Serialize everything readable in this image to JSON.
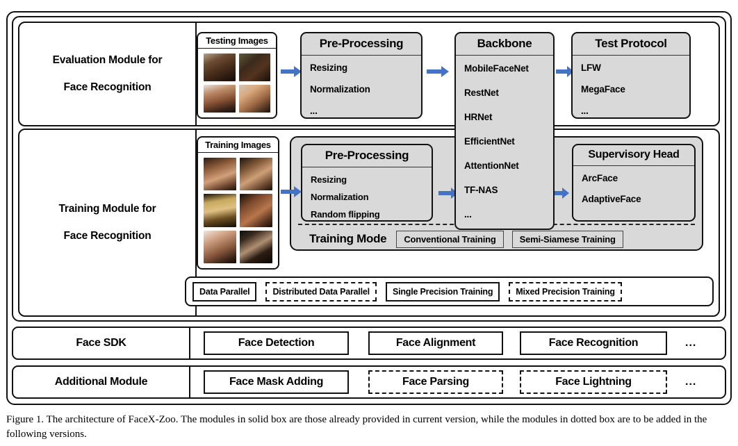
{
  "figure": {
    "caption": "Figure 1. The architecture of FaceX-Zoo. The modules in solid box are those already provided in current version, while the modules in dotted box are to be added in the following versions."
  },
  "colors": {
    "arrow": "#4472C4",
    "panel_fill": "#D9D9D9",
    "border": "#111111",
    "page_background": "#FFFFFF"
  },
  "evaluation_module": {
    "label_line1": "Evaluation Module for",
    "label_line2": "Face Recognition",
    "images_card": {
      "title": "Testing Images",
      "face_count": 4
    },
    "preprocessing": {
      "title": "Pre-Processing",
      "items": [
        "Resizing",
        "Normalization",
        "..."
      ]
    },
    "test_protocol": {
      "title": "Test Protocol",
      "items": [
        "LFW",
        "MegaFace",
        "..."
      ]
    }
  },
  "training_module": {
    "label_line1": "Training Module for",
    "label_line2": "Face Recognition",
    "images_card": {
      "title": "Training Images",
      "face_count": 6
    },
    "preprocessing": {
      "title": "Pre-Processing",
      "items": [
        "Resizing",
        "Normalization",
        "Random flipping",
        "..."
      ]
    },
    "supervisory_head": {
      "title": "Supervisory Head",
      "items": [
        "ArcFace",
        "AdaptiveFace",
        "..."
      ]
    },
    "training_mode": {
      "label": "Training Mode",
      "options": [
        "Conventional Training",
        "Semi-Siamese Training"
      ]
    }
  },
  "backbone": {
    "title": "Backbone",
    "items": [
      "MobileFaceNet",
      "RestNet",
      "HRNet",
      "EfficientNet",
      "AttentionNet",
      "TF-NAS",
      "..."
    ]
  },
  "parallel_strip": {
    "boxes": [
      {
        "label": "Data Parallel",
        "style": "solid"
      },
      {
        "label": "Distributed Data Parallel",
        "style": "dotted"
      },
      {
        "label": "Single Precision Training",
        "style": "solid"
      },
      {
        "label": "Mixed Precision Training",
        "style": "dotted"
      }
    ]
  },
  "face_sdk_row": {
    "label": "Face SDK",
    "items": [
      {
        "label": "Face Detection",
        "style": "solid"
      },
      {
        "label": "Face Alignment",
        "style": "solid"
      },
      {
        "label": "Face Recognition",
        "style": "solid"
      }
    ],
    "trailing": "..."
  },
  "additional_module_row": {
    "label": "Additional Module",
    "items": [
      {
        "label": "Face Mask Adding",
        "style": "solid"
      },
      {
        "label": "Face Parsing",
        "style": "dotted"
      },
      {
        "label": "Face Lightning",
        "style": "dotted"
      }
    ],
    "trailing": "..."
  }
}
